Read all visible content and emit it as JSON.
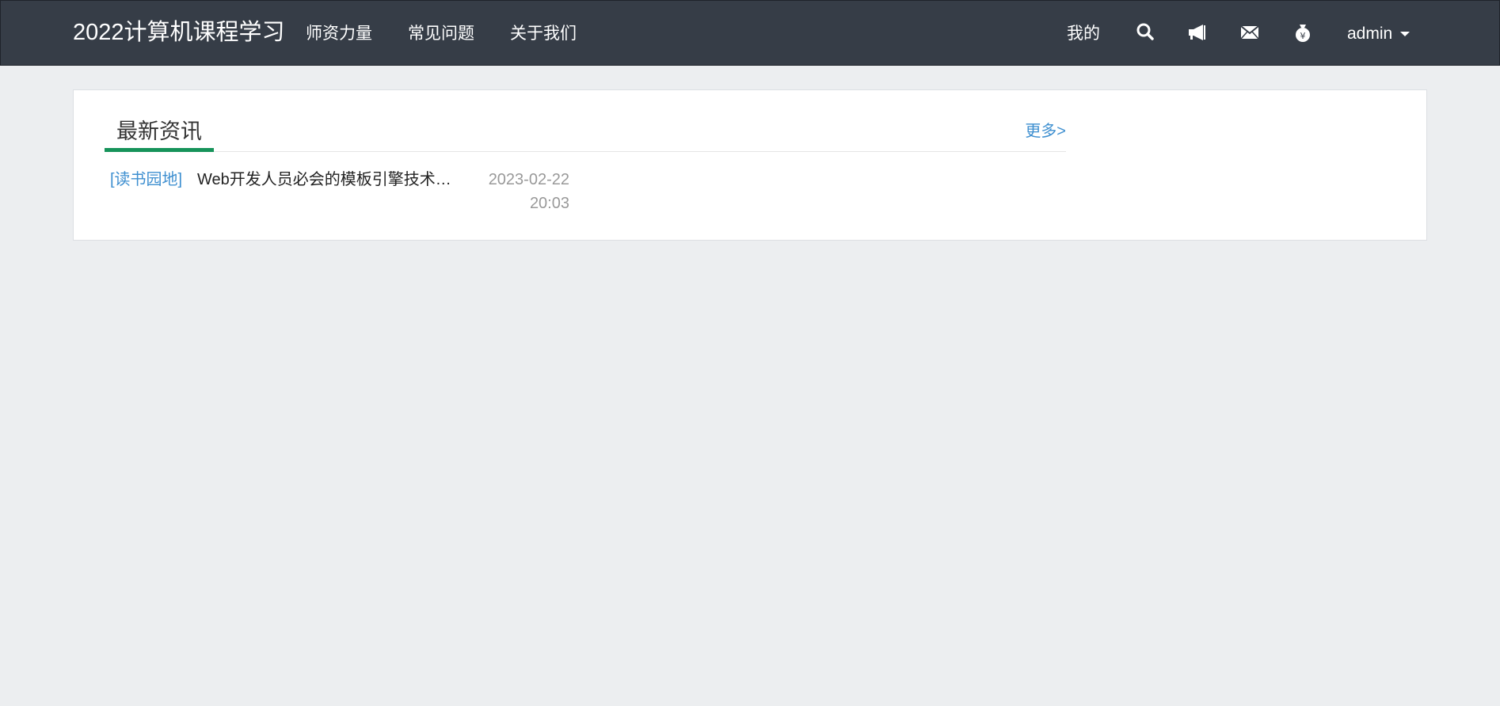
{
  "navbar": {
    "brand": "2022计算机课程学习",
    "links": [
      {
        "label": "师资力量"
      },
      {
        "label": "常见问题"
      },
      {
        "label": "关于我们"
      }
    ],
    "mine_label": "我的",
    "icons": [
      "search-icon",
      "megaphone-icon",
      "envelope-icon",
      "money-bag-icon"
    ],
    "user": "admin",
    "background_color": "#363d47"
  },
  "news_section": {
    "title": "最新资讯",
    "more_label": "更多>",
    "accent_color": "#16935a",
    "link_color": "#3e8fd0",
    "items": [
      {
        "category": "[读书园地]",
        "title": "Web开发人员必会的模板引擎技术…",
        "date": "2023-02-22",
        "time": "20:03"
      }
    ]
  }
}
